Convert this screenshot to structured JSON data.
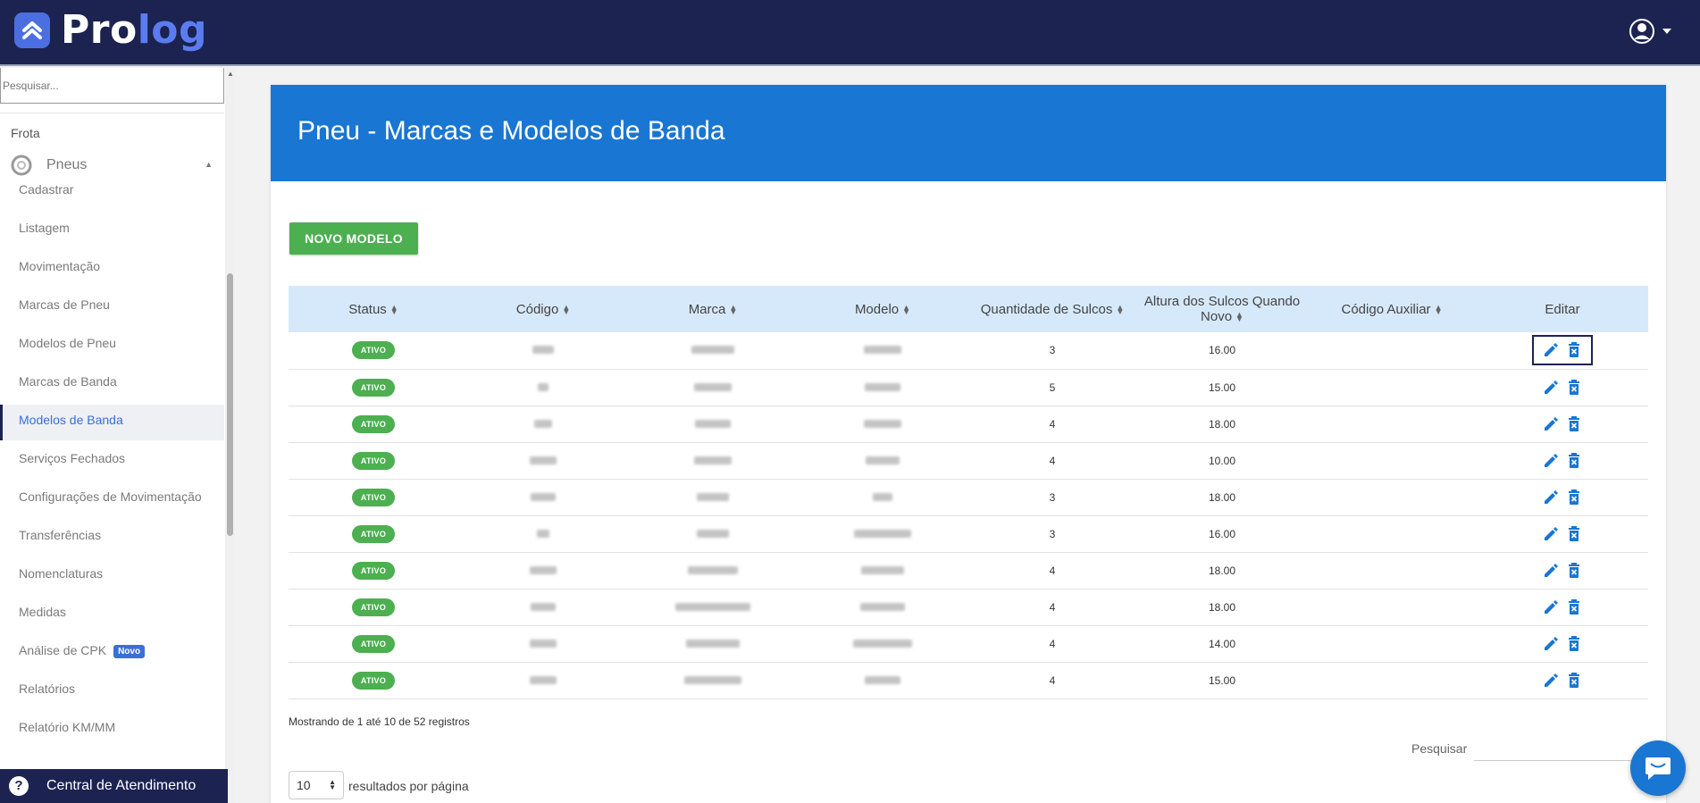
{
  "app": {
    "logo_main": "Pro",
    "logo_accent": "log"
  },
  "sidebar": {
    "search_placeholder": "Pesquisar...",
    "section": "Frota",
    "group": "Pneus",
    "items": [
      {
        "label": "Cadastrar",
        "active": false
      },
      {
        "label": "Listagem",
        "active": false
      },
      {
        "label": "Movimentação",
        "active": false
      },
      {
        "label": "Marcas de Pneu",
        "active": false
      },
      {
        "label": "Modelos de Pneu",
        "active": false
      },
      {
        "label": "Marcas de Banda",
        "active": false
      },
      {
        "label": "Modelos de Banda",
        "active": true
      },
      {
        "label": "Serviços Fechados",
        "active": false
      },
      {
        "label": "Configurações de Movimentação",
        "active": false
      },
      {
        "label": "Transferências",
        "active": false
      },
      {
        "label": "Nomenclaturas",
        "active": false
      },
      {
        "label": "Medidas",
        "active": false
      },
      {
        "label": "Análise de CPK",
        "active": false,
        "badge": "Novo"
      },
      {
        "label": "Relatórios",
        "active": false
      },
      {
        "label": "Relatório KM/MM",
        "active": false
      }
    ],
    "help_label": "Central de Atendimento"
  },
  "page": {
    "title": "Pneu - Marcas e Modelos de Banda",
    "new_button": "NOVO MODELO"
  },
  "table": {
    "columns": {
      "status": "Status",
      "codigo": "Código",
      "marca": "Marca",
      "modelo": "Modelo",
      "sulcos": "Quantidade de Sulcos",
      "altura": "Altura dos Sulcos Quando Novo",
      "aux": "Código Auxiliar",
      "editar": "Editar"
    },
    "rows": [
      {
        "status": "ATIVO",
        "sulcos": "3",
        "altura": "16.00"
      },
      {
        "status": "ATIVO",
        "sulcos": "5",
        "altura": "15.00"
      },
      {
        "status": "ATIVO",
        "sulcos": "4",
        "altura": "18.00"
      },
      {
        "status": "ATIVO",
        "sulcos": "4",
        "altura": "10.00"
      },
      {
        "status": "ATIVO",
        "sulcos": "3",
        "altura": "18.00"
      },
      {
        "status": "ATIVO",
        "sulcos": "3",
        "altura": "16.00"
      },
      {
        "status": "ATIVO",
        "sulcos": "4",
        "altura": "18.00"
      },
      {
        "status": "ATIVO",
        "sulcos": "4",
        "altura": "18.00"
      },
      {
        "status": "ATIVO",
        "sulcos": "4",
        "altura": "14.00"
      },
      {
        "status": "ATIVO",
        "sulcos": "4",
        "altura": "15.00"
      }
    ],
    "info": "Mostrando de 1 até 10 de 52 registros",
    "search_label": "Pesquisar",
    "page_size": "10",
    "page_size_label": "resultados por página"
  },
  "colors": {
    "topbar": "#1c2350",
    "header": "#1976d2",
    "success": "#4caf50",
    "icon": "#1976d2"
  },
  "icons": {
    "edit": "pencil-icon",
    "delete": "trash-icon",
    "account": "user-circle-icon",
    "chat": "chat-icon",
    "help": "question-icon"
  }
}
